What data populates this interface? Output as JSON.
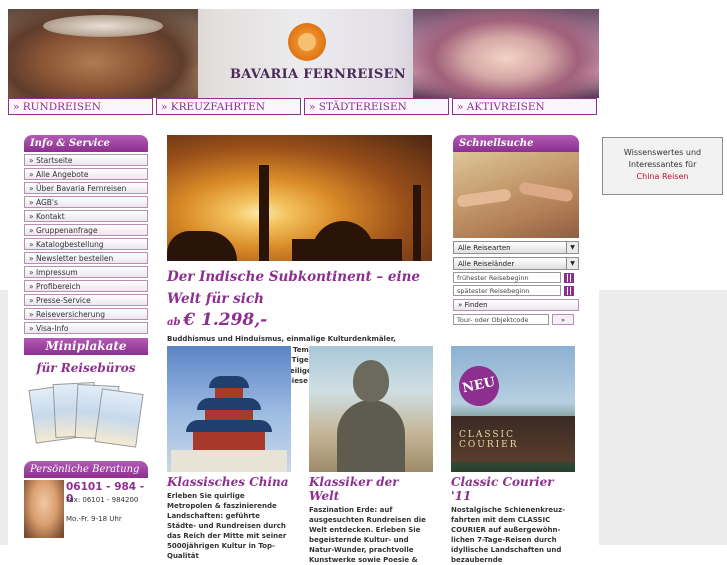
{
  "brand": {
    "name": "BAVARIA FERNREISEN"
  },
  "nav": {
    "items": [
      {
        "label": "» RUNDREISEN"
      },
      {
        "label": "» KREUZFAHRTEN"
      },
      {
        "label": "» STÄDTEREISEN"
      },
      {
        "label": "» AKTIVREISEN"
      }
    ]
  },
  "sidebar": {
    "title": "Info & Service",
    "items": [
      {
        "label": "» Startseite"
      },
      {
        "label": "» Alle Angebote"
      },
      {
        "label": "» Über Bavaria Fernreisen"
      },
      {
        "label": "» AGB's"
      },
      {
        "label": "» Kontakt"
      },
      {
        "label": "» Gruppenanfrage"
      },
      {
        "label": "» Katalogbestellung"
      },
      {
        "label": "» Newsletter bestellen"
      },
      {
        "label": "» Impressum"
      },
      {
        "label": "» Profibereich"
      },
      {
        "label": "» Presse-Service"
      },
      {
        "label": "» Reiseversicherung"
      },
      {
        "label": "» Visa-Info"
      }
    ],
    "miniplakate": {
      "title": "Miniplakate",
      "subtitle": "für Reisebüros"
    },
    "beratung": {
      "title": "Persönliche Beratung",
      "phone": "06101 - 984 - 0",
      "fax": "Fax: 06101 - 984200",
      "hours": "Mo.-Fr. 9-18 Uhr"
    }
  },
  "hero": {
    "title": "Der Indische Subkontinent – eine Welt für sich",
    "price_prefix": "ab",
    "price": "€ 1.298,-",
    "description": "Buddhismus und Hinduismus, einmalige Kulturdenkmäler, prachtvolle leuchtende Farben, Tempel und Paläste, Bergwelt des Himalaya und endlose Wüsten, Tiger und Dschungel, Curry und Tandoori, heilige Männer und heilige Flüsse – entdecken Sie mit uns auf beispielhaften Reisen diese faszinierende Welt.Ibinsel."
  },
  "tiles": [
    {
      "title": "Klassisches China",
      "text": "Erleben Sie quirlige Metropolen & faszinierende Landschaften: geführte Städte- und Rundreisen durch das Reich der Mitte mit seiner 5000jährigen Kultur in Top-Qualität"
    },
    {
      "title": "Klassiker der Welt",
      "text": "Faszination Erde: auf ausgesuchten Rundreisen die Welt entdecken. Erleben Sie begeisternde Kultur- und Natur-Wunder, prachtvolle Kunstwerke sowie Poesie &"
    },
    {
      "title": "Classic Courier '11",
      "badge": "NEU",
      "image_label": "CLASSIC COURIER",
      "text": "Nostalgische Schienenkreuz-fahrten mit dem CLASSIC COURIER auf außergewöhn-lichen 7-Tage-Reisen durch idyllische Landschaften und bezaubernde"
    }
  ],
  "schnellsuche": {
    "title": "Schnellsuche",
    "select_reisearten": "Alle Reisearten",
    "select_laender": "Alle Reiseländer",
    "placeholder_earliest": "frühester Reisebeginn",
    "placeholder_latest": "spätester Reisebeginn",
    "find_label": "» Finden",
    "placeholder_code": "Tour- oder Objektcode",
    "go_label": "»"
  },
  "info_box": {
    "line1": "Wissenswertes und",
    "line2": "Interessantes für",
    "link": "China Reisen"
  },
  "colors": {
    "accent": "#8c2f8f",
    "link": "#c8102e"
  }
}
